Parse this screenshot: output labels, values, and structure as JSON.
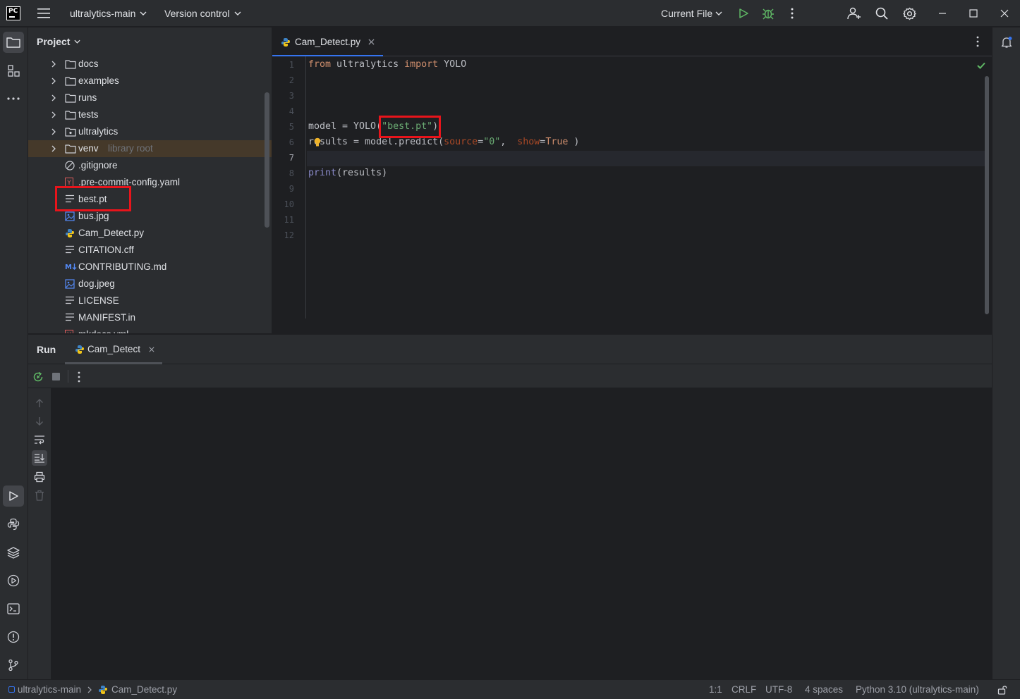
{
  "titlebar": {
    "project_name": "ultralytics-main",
    "vcs_label": "Version control",
    "run_config": "Current File"
  },
  "project_panel": {
    "title": "Project",
    "items": [
      {
        "name": "docs",
        "type": "folder",
        "expandable": true
      },
      {
        "name": "examples",
        "type": "folder",
        "expandable": true
      },
      {
        "name": "runs",
        "type": "folder",
        "expandable": true
      },
      {
        "name": "tests",
        "type": "folder",
        "expandable": true
      },
      {
        "name": "ultralytics",
        "type": "package",
        "expandable": true
      },
      {
        "name": "venv",
        "hint": "library root",
        "type": "folder",
        "expandable": true,
        "selected": true
      },
      {
        "name": ".gitignore",
        "type": "ignore"
      },
      {
        "name": ".pre-commit-config.yaml",
        "type": "yaml"
      },
      {
        "name": "best.pt",
        "type": "text",
        "highlighted": true
      },
      {
        "name": "bus.jpg",
        "type": "image"
      },
      {
        "name": "Cam_Detect.py",
        "type": "python"
      },
      {
        "name": "CITATION.cff",
        "type": "text"
      },
      {
        "name": "CONTRIBUTING.md",
        "type": "markdown"
      },
      {
        "name": "dog.jpeg",
        "type": "image"
      },
      {
        "name": "LICENSE",
        "type": "text"
      },
      {
        "name": "MANIFEST.in",
        "type": "text"
      },
      {
        "name": "mkdocs.yml",
        "type": "yaml"
      }
    ]
  },
  "editor": {
    "tab_label": "Cam_Detect.py",
    "line_numbers": [
      "1",
      "2",
      "3",
      "4",
      "5",
      "6",
      "7",
      "8",
      "9",
      "10",
      "11",
      "12"
    ],
    "current_line": 7,
    "code": {
      "l1_from": "from",
      "l1_mod": " ultralytics ",
      "l1_import": "import",
      "l1_name": " YOLO",
      "l5_pre": "model = YOLO(",
      "l5_str": "\"best.pt\"",
      "l5_post": ")",
      "l6_pre": "results = model.predict(",
      "l6_p1": "source",
      "l6_eq1": "=",
      "l6_s1": "\"0\"",
      "l6_mid": ",  ",
      "l6_p2": "show",
      "l6_eq2": "=",
      "l6_true": "True",
      "l6_post": " )",
      "l8_fn": "print",
      "l8_rest": "(results)"
    },
    "inspection_status": "no problems",
    "highlighted_text": "\"best.pt\""
  },
  "run_panel": {
    "title": "Run",
    "tab_label": "Cam_Detect"
  },
  "statusbar": {
    "breadcrumb_project": "ultralytics-main",
    "breadcrumb_file": "Cam_Detect.py",
    "position": "1:1",
    "line_sep": "CRLF",
    "encoding": "UTF-8",
    "indent": "4 spaces",
    "interpreter": "Python 3.10 (ultralytics-main)"
  },
  "colors": {
    "highlight_box": "#e8141b",
    "accent": "#3574f0",
    "selected_row": "#45392a"
  }
}
